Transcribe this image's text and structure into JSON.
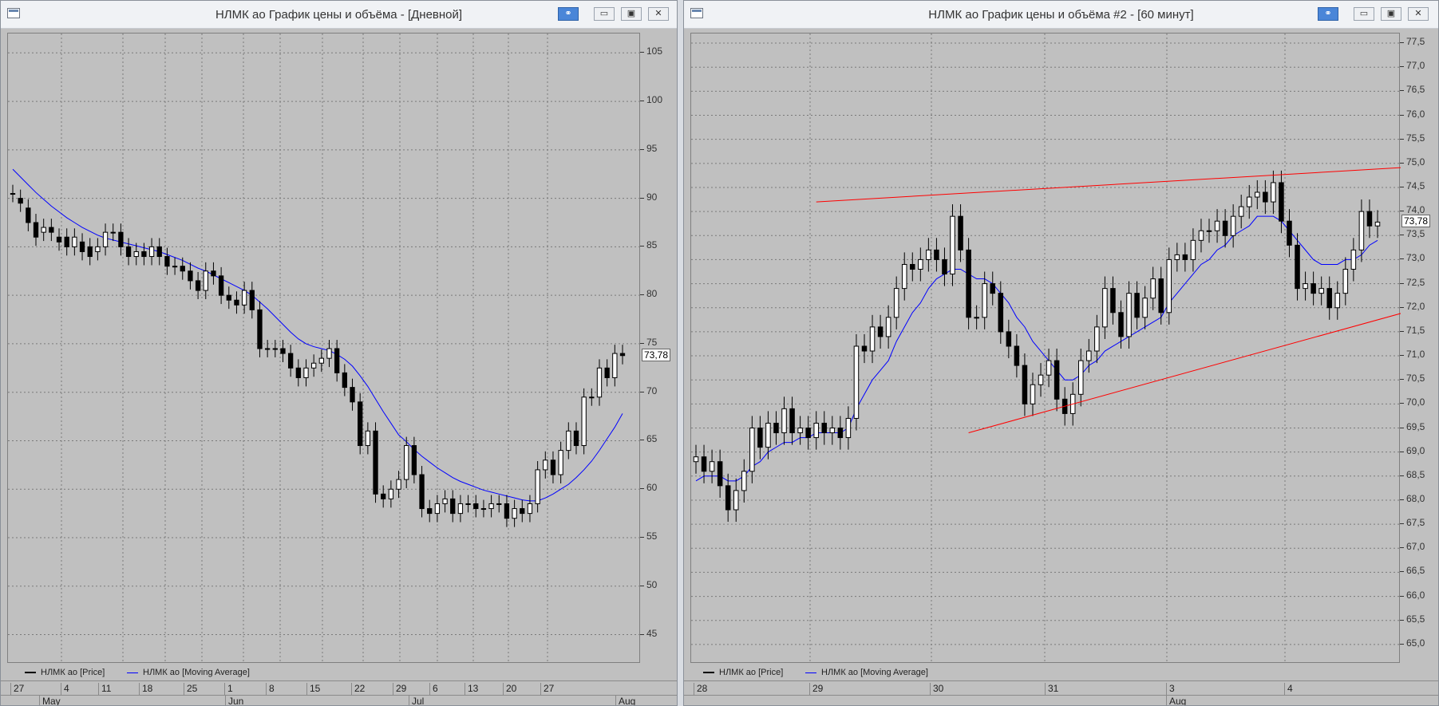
{
  "colors": {
    "plot_bg": "#c0c0c0",
    "grid": "#7a7a7a",
    "ma_line": "#0000ff",
    "trend_line": "#ff0000",
    "candle_up": "#ffffff",
    "candle_down": "#000000"
  },
  "window1": {
    "title": "НЛМК ао График цены и объёма - [Дневной]",
    "buttons": {
      "link": "link-icon",
      "minimize": "▭",
      "restore": "▣",
      "close": "✕"
    },
    "last_price": "73,78",
    "legend": [
      "НЛМК ао [Price]",
      "НЛМК ао [Moving Average]"
    ],
    "x_row1": [
      "27",
      "4",
      "11",
      "18",
      "25",
      "1",
      "8",
      "15",
      "22",
      "29",
      "6",
      "13",
      "20",
      "27"
    ],
    "x_row2": [
      "May",
      "Jun",
      "Jul",
      "Aug"
    ],
    "chart_data": {
      "type": "candlestick",
      "ylim": [
        42,
        107
      ],
      "yticks": [
        "45",
        "50",
        "55",
        "60",
        "65",
        "70",
        "75",
        "80",
        "85",
        "90",
        "95",
        "100",
        "105"
      ],
      "close": [
        90.5,
        89.5,
        87.5,
        86.0,
        87.0,
        86.5,
        85.5,
        85.0,
        86.0,
        84.5,
        84.0,
        85.0,
        86.5,
        86.5,
        85.0,
        84.0,
        84.5,
        84.0,
        85.0,
        84.0,
        83.0,
        83.0,
        82.5,
        81.5,
        80.5,
        82.5,
        82.0,
        80.0,
        79.5,
        79.0,
        80.5,
        78.5,
        74.5,
        74.5,
        74.5,
        74.0,
        72.5,
        71.5,
        72.5,
        73.0,
        73.5,
        74.5,
        72.0,
        70.5,
        69.0,
        64.5,
        66.0,
        59.5,
        59.0,
        60.0,
        61.0,
        64.5,
        61.5,
        58.0,
        57.5,
        58.5,
        59.0,
        57.5,
        58.5,
        58.5,
        58.0,
        58.0,
        58.5,
        58.5,
        57.0,
        58.0,
        57.5,
        58.5,
        62.0,
        63.0,
        61.5,
        64.0,
        66.0,
        64.5,
        69.5,
        69.5,
        72.5,
        71.5,
        74.0,
        73.78
      ],
      "open": [
        90.5,
        90.0,
        89.0,
        87.5,
        86.5,
        87.0,
        86.0,
        86.0,
        85.0,
        85.5,
        85.0,
        84.5,
        85.0,
        86.5,
        86.5,
        85.0,
        84.0,
        84.5,
        84.0,
        85.0,
        84.0,
        83.0,
        83.0,
        82.5,
        81.5,
        80.5,
        82.5,
        82.0,
        80.0,
        79.5,
        79.0,
        80.5,
        78.5,
        74.5,
        74.5,
        74.5,
        74.0,
        72.5,
        71.5,
        72.5,
        73.0,
        73.5,
        74.5,
        72.0,
        70.5,
        69.0,
        64.5,
        66.0,
        59.5,
        59.0,
        60.0,
        61.0,
        64.5,
        61.5,
        58.0,
        57.5,
        58.5,
        59.0,
        57.5,
        58.5,
        58.5,
        58.0,
        58.0,
        58.5,
        58.5,
        57.0,
        58.0,
        57.5,
        58.5,
        62.0,
        63.0,
        61.5,
        64.0,
        66.0,
        64.5,
        69.5,
        69.5,
        72.5,
        71.5,
        74.0
      ],
      "ma": [
        93.0,
        92.2,
        91.4,
        90.6,
        89.9,
        89.2,
        88.6,
        88.0,
        87.5,
        87.0,
        86.6,
        86.2,
        85.9,
        85.7,
        85.5,
        85.3,
        85.1,
        84.9,
        84.7,
        84.5,
        84.2,
        83.9,
        83.6,
        83.2,
        82.8,
        82.5,
        82.1,
        81.7,
        81.3,
        80.9,
        80.5,
        80.0,
        79.3,
        78.6,
        77.8,
        77.0,
        76.2,
        75.5,
        75.0,
        74.7,
        74.5,
        74.3,
        73.9,
        73.4,
        72.7,
        71.7,
        70.6,
        69.3,
        68.0,
        66.8,
        65.6,
        64.9,
        64.1,
        63.4,
        62.8,
        62.2,
        61.7,
        61.2,
        60.8,
        60.5,
        60.2,
        59.9,
        59.7,
        59.5,
        59.3,
        59.1,
        58.9,
        58.8,
        58.8,
        59.1,
        59.5,
        60.0,
        60.5,
        61.2,
        62.0,
        62.9,
        64.0,
        65.2,
        66.4,
        67.8
      ]
    }
  },
  "window2": {
    "title": "НЛМК ао График цены и объёма #2 - [60 минут]",
    "buttons": {
      "link": "link-icon",
      "minimize": "▭",
      "restore": "▣",
      "close": "✕"
    },
    "last_price": "73,78",
    "legend": [
      "НЛМК ао [Price]",
      "НЛМК ао [Moving Average]"
    ],
    "x_row1": [
      "28",
      "29",
      "30",
      "31",
      "3",
      "4"
    ],
    "x_row2": [
      "Aug"
    ],
    "chart_data": {
      "type": "candlestick",
      "ylim": [
        64.6,
        77.7
      ],
      "yticks": [
        "65,0",
        "65,5",
        "66,0",
        "66,5",
        "67,0",
        "67,5",
        "68,0",
        "68,5",
        "69,0",
        "69,5",
        "70,0",
        "70,5",
        "71,0",
        "71,5",
        "72,0",
        "72,5",
        "73,0",
        "73,5",
        "74,0",
        "74,5",
        "75,0",
        "75,5",
        "76,0",
        "76,5",
        "77,0",
        "77,5"
      ],
      "close": [
        68.9,
        68.6,
        68.8,
        68.3,
        67.8,
        68.2,
        68.6,
        69.5,
        69.1,
        69.6,
        69.4,
        69.9,
        69.4,
        69.5,
        69.3,
        69.6,
        69.4,
        69.5,
        69.3,
        69.7,
        71.2,
        71.1,
        71.6,
        71.4,
        71.8,
        72.4,
        72.9,
        72.8,
        73.0,
        73.2,
        73.0,
        72.7,
        73.9,
        73.2,
        71.8,
        71.8,
        72.5,
        72.3,
        71.5,
        71.2,
        70.8,
        70.0,
        70.4,
        70.6,
        70.9,
        70.1,
        69.8,
        70.2,
        70.9,
        71.1,
        71.6,
        72.4,
        71.9,
        71.4,
        72.3,
        71.8,
        72.2,
        72.6,
        71.9,
        73.0,
        73.1,
        73.0,
        73.4,
        73.6,
        73.6,
        73.8,
        73.5,
        73.9,
        74.1,
        74.3,
        74.4,
        74.2,
        74.6,
        73.8,
        73.3,
        72.4,
        72.5,
        72.3,
        72.4,
        72.0,
        72.3,
        72.8,
        73.2,
        74.0,
        73.7,
        73.78
      ],
      "open": [
        68.8,
        68.9,
        68.6,
        68.8,
        68.3,
        67.8,
        68.2,
        68.6,
        69.5,
        69.1,
        69.6,
        69.4,
        69.9,
        69.4,
        69.5,
        69.3,
        69.6,
        69.4,
        69.5,
        69.3,
        69.7,
        71.2,
        71.1,
        71.6,
        71.4,
        71.8,
        72.4,
        72.9,
        72.8,
        73.0,
        73.2,
        73.0,
        72.7,
        73.9,
        73.2,
        71.8,
        71.8,
        72.5,
        72.3,
        71.5,
        71.2,
        70.8,
        70.0,
        70.4,
        70.6,
        70.9,
        70.1,
        69.8,
        70.2,
        70.9,
        71.1,
        71.6,
        72.4,
        71.9,
        71.4,
        72.3,
        71.8,
        72.2,
        72.6,
        71.9,
        73.0,
        73.1,
        73.0,
        73.4,
        73.6,
        73.6,
        73.8,
        73.5,
        73.9,
        74.1,
        74.3,
        74.4,
        74.2,
        74.6,
        73.8,
        73.3,
        72.4,
        72.5,
        72.3,
        72.4,
        72.0,
        72.3,
        72.8,
        73.2,
        74.0,
        73.7
      ],
      "ma": [
        68.4,
        68.5,
        68.5,
        68.5,
        68.4,
        68.4,
        68.5,
        68.7,
        68.8,
        69.0,
        69.1,
        69.2,
        69.2,
        69.3,
        69.3,
        69.4,
        69.4,
        69.4,
        69.4,
        69.5,
        69.9,
        70.2,
        70.5,
        70.7,
        70.9,
        71.3,
        71.6,
        71.9,
        72.1,
        72.4,
        72.6,
        72.7,
        72.8,
        72.8,
        72.7,
        72.6,
        72.6,
        72.5,
        72.3,
        72.1,
        71.8,
        71.6,
        71.3,
        71.1,
        70.9,
        70.7,
        70.5,
        70.5,
        70.6,
        70.8,
        70.9,
        71.1,
        71.2,
        71.3,
        71.4,
        71.5,
        71.6,
        71.7,
        71.8,
        72.1,
        72.3,
        72.5,
        72.7,
        72.9,
        73.0,
        73.2,
        73.3,
        73.5,
        73.6,
        73.7,
        73.9,
        73.9,
        73.9,
        73.8,
        73.6,
        73.4,
        73.2,
        73.0,
        72.9,
        72.9,
        72.9,
        73.0,
        73.0,
        73.1,
        73.3,
        73.4
      ],
      "trendlines": [
        {
          "from": [
            15,
            74.2
          ],
          "to": [
            97,
            75.0
          ]
        },
        {
          "from": [
            34,
            69.4
          ],
          "to": [
            97,
            72.3
          ]
        }
      ]
    }
  }
}
